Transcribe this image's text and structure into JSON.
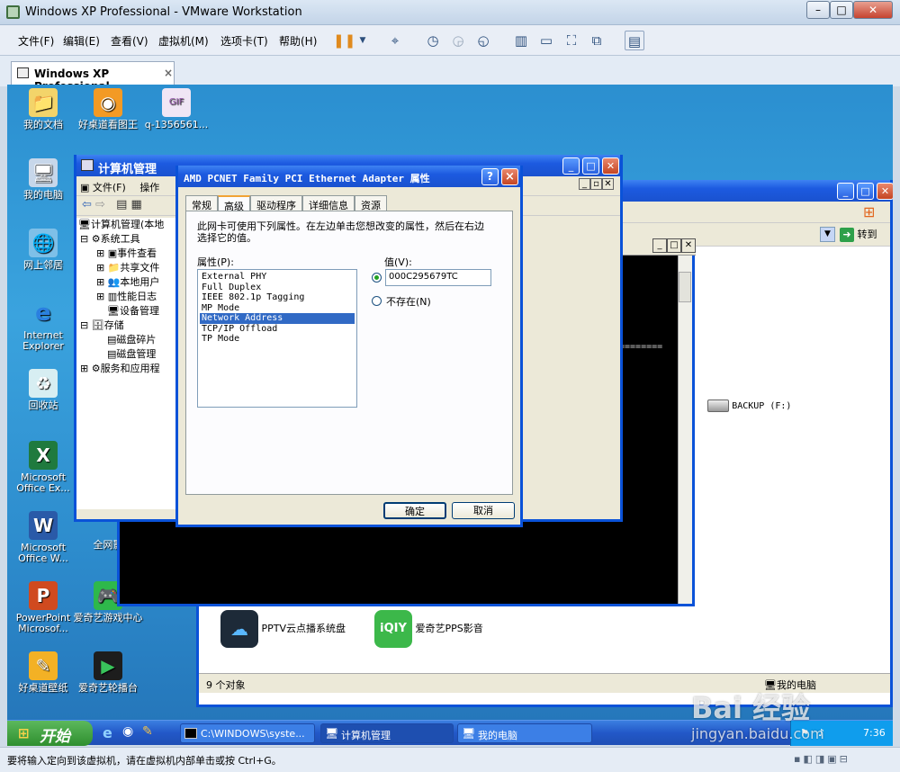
{
  "window": {
    "title": "Windows XP Professional - VMware Workstation"
  },
  "menu": [
    "文件(F)",
    "编辑(E)",
    "查看(V)",
    "虚拟机(M)",
    "选项卡(T)",
    "帮助(H)"
  ],
  "tab": {
    "label": "Windows XP Professional",
    "close": "×"
  },
  "desktop_icons": [
    "我的文档",
    "好桌道看图王",
    "q-1356561...",
    "我的电脑",
    "网上邻居",
    "Internet Explorer",
    "回收站",
    "Microsoft Office Ex...",
    "Microsoft Office W...",
    "全网影",
    "PowerPoint Microsof...",
    "爱奇艺游戏中心",
    "好桌道壁纸",
    "爱奇艺轮播台"
  ],
  "comp_mgmt": {
    "title": "计算机管理",
    "menu": [
      "文件(F)",
      "操作"
    ],
    "tree": [
      "计算机管理(本地",
      "系统工具",
      "事件查看",
      "共享文件",
      "本地用户",
      "性能日志",
      "设备管理",
      "存储",
      "磁盘碎片",
      "磁盘管理",
      "服务和应用程"
    ]
  },
  "my_computer": {
    "goto": "转到",
    "drive": "BACKUP (F:)",
    "status": "9 个对象",
    "status_right": "我的电脑",
    "apps": [
      "PPTV云点播系统盘",
      "爱奇艺PPS影音"
    ]
  },
  "cmd": {
    "separator": "========"
  },
  "dialog": {
    "title": "AMD PCNET Family PCI Ethernet Adapter 属性",
    "help": "?",
    "close": "×",
    "tabs": [
      "常规",
      "高级",
      "驱动程序",
      "详细信息",
      "资源"
    ],
    "desc": "此网卡可使用下列属性。在左边单击您想改变的属性，然后在右边选择它的值。",
    "prop_label": "属性(P):",
    "value_label": "值(V):",
    "properties": [
      "External PHY",
      "Full Duplex",
      "IEEE 802.1p Tagging",
      "MP Mode",
      "Network Address",
      "TCP/IP Offload",
      "TP Mode"
    ],
    "selected_index": 4,
    "value": "000C295679TC",
    "not_present": "不存在(N)",
    "ok": "确定",
    "cancel": "取消"
  },
  "taskbar": {
    "start": "开始",
    "tasks": [
      "C:\\WINDOWS\\syste...",
      "计算机管理",
      "我的电脑"
    ],
    "time": "7:36"
  },
  "statusbar": "要将输入定向到该虚拟机，请在虚拟机内部单击或按 Ctrl+G。",
  "watermark": {
    "brand": "Bai 经验",
    "url": "jingyan.baidu.com"
  }
}
